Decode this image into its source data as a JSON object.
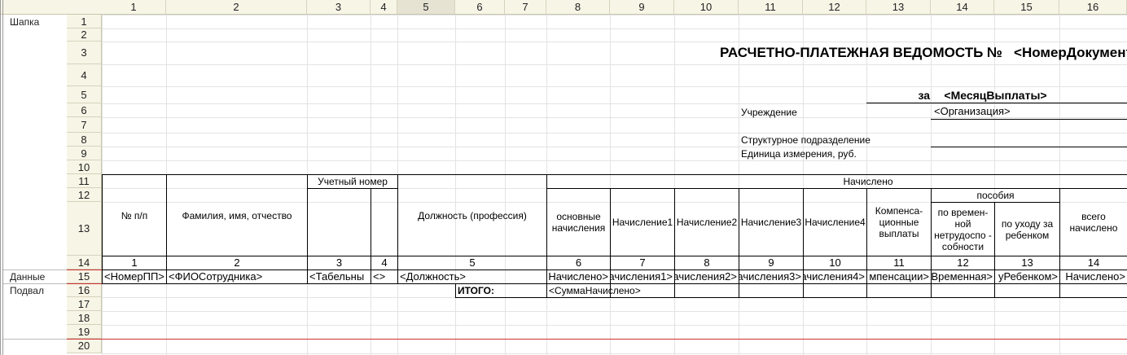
{
  "column_headers": [
    "1",
    "2",
    "3",
    "4",
    "5",
    "6",
    "7",
    "8",
    "9",
    "10",
    "11",
    "12",
    "13",
    "14",
    "15",
    "16"
  ],
  "selected_column": "5",
  "row_headers": [
    "1",
    "2",
    "3",
    "4",
    "5",
    "6",
    "7",
    "8",
    "9",
    "10",
    "11",
    "12",
    "13",
    "14",
    "15",
    "16",
    "17",
    "18",
    "19",
    "20"
  ],
  "sections": {
    "header": "Шапка",
    "data": "Данные",
    "footer": "Подвал"
  },
  "title": {
    "text": "РАСЧЕТНО-ПЛАТЕЖНАЯ ВЕДОМОСТЬ №",
    "number_param": "<НомерДокумента>",
    "for_label": "за",
    "month_param": "<МесяцВыплаты>",
    "institution_label": "Учреждение",
    "institution_param": "<Организация>",
    "department_label": "Структурное подразделение",
    "unit_label": "Единица измерения, руб."
  },
  "table_header": {
    "num": "№ п/п",
    "fio": "Фамилия, имя, отчество",
    "account_number": "Учетный номер",
    "position": "Должность (профессия)",
    "accrued": "Начислено",
    "basic": "основные начисления",
    "accrual1": "Начисление1",
    "accrual2": "Начисление2",
    "accrual3": "Начисление3",
    "accrual4": "Начисление4",
    "compensation": "Компенса-ционные выплаты",
    "benefits": "пособия",
    "temp_disability": "по времен-ной нетрудоспо - собности",
    "child_care": "по уходу за ребенком",
    "total": "всего начислено",
    "numbers": [
      "1",
      "2",
      "3",
      "4",
      "5",
      "6",
      "7",
      "8",
      "9",
      "10",
      "11",
      "12",
      "13",
      "14"
    ]
  },
  "data_row": [
    "<НомерПП>",
    "<ФИОСотрудника>",
    "<Табельны",
    "<>",
    "<Должность>",
    "Начислено>",
    "ачисления1>",
    "ачисления2>",
    "ачисления3>",
    "ачисления4>",
    "мпенсации>",
    "Временная>",
    "уРебенком>",
    "Начислено>"
  ],
  "footer": {
    "total_label": "ИТОГО:",
    "sum_param": "<СуммаНачислено>"
  }
}
